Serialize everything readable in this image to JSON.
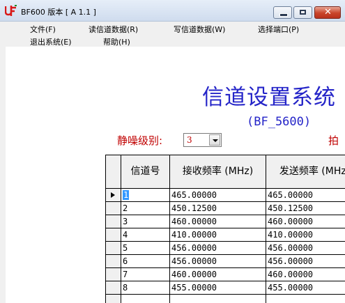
{
  "window": {
    "title": "BF600 版本 [ A 1.1 ]",
    "close_glyph": "✕"
  },
  "menu": {
    "items": [
      {
        "label": "文件(F)"
      },
      {
        "label": "读信道数据(R)"
      },
      {
        "label": "写信道数据(W)"
      },
      {
        "label": "选择端口(P)"
      },
      {
        "label": "退出系统(E)"
      },
      {
        "label": "帮助(H)"
      }
    ]
  },
  "main": {
    "heading": "信道设置系统",
    "subheading": "(BF_5600)",
    "squelch_label": "静噪级别:",
    "squelch_value": "3",
    "right_label": "拍"
  },
  "grid": {
    "columns": [
      "信道号",
      "接收频率 (MHz)",
      "发送频率 (MHz)"
    ],
    "rows": [
      {
        "channel": "1",
        "rx": "465.00000",
        "tx": "465.00000"
      },
      {
        "channel": "2",
        "rx": "450.12500",
        "tx": "450.12500"
      },
      {
        "channel": "3",
        "rx": "460.00000",
        "tx": "460.00000"
      },
      {
        "channel": "4",
        "rx": "410.00000",
        "tx": "410.00000"
      },
      {
        "channel": "5",
        "rx": "456.00000",
        "tx": "456.00000"
      },
      {
        "channel": "6",
        "rx": "456.00000",
        "tx": "456.00000"
      },
      {
        "channel": "7",
        "rx": "460.00000",
        "tx": "460.00000"
      },
      {
        "channel": "8",
        "rx": "455.00000",
        "tx": "455.00000"
      },
      {
        "channel": "",
        "rx": "",
        "tx": ""
      }
    ]
  },
  "colors": {
    "heading": "#2424c8",
    "label_red": "#c00000",
    "selection": "#3399ff"
  }
}
